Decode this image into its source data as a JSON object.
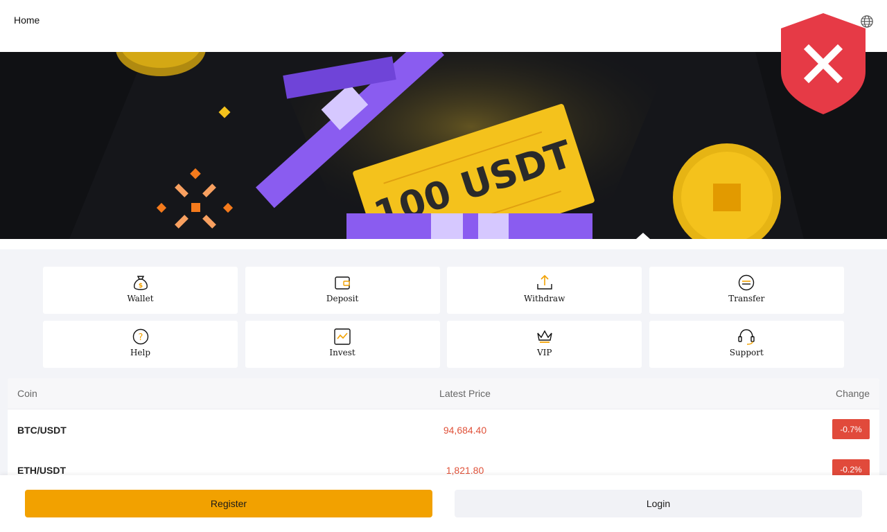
{
  "header": {
    "home_label": "Home",
    "language_icon": "globe-icon"
  },
  "banner": {
    "ticket_text": "100 USDT",
    "slide_count": 4,
    "active_slide": 0,
    "colors": {
      "gold": "#f4c21c",
      "purple": "#8a5cf0",
      "background": "#15161a"
    }
  },
  "security_badge": {
    "icon": "shield-x-icon",
    "color": "#e63a46"
  },
  "actions": [
    {
      "label": "Wallet",
      "icon": "money-bag-icon"
    },
    {
      "label": "Deposit",
      "icon": "wallet-icon"
    },
    {
      "label": "Withdraw",
      "icon": "upload-icon"
    },
    {
      "label": "Transfer",
      "icon": "transfer-icon"
    },
    {
      "label": "Help",
      "icon": "question-icon"
    },
    {
      "label": "Invest",
      "icon": "chart-icon"
    },
    {
      "label": "VIP",
      "icon": "crown-icon"
    },
    {
      "label": "Support",
      "icon": "headset-icon"
    }
  ],
  "market": {
    "columns": {
      "coin": "Coin",
      "price": "Latest Price",
      "change": "Change"
    },
    "rows": [
      {
        "pair": "BTC/USDT",
        "price": "94,684.40",
        "change": "-0.7%"
      },
      {
        "pair": "ETH/USDT",
        "price": "1,821.80",
        "change": "-0.2%"
      }
    ]
  },
  "footer": {
    "register_label": "Register",
    "login_label": "Login",
    "accent": "#f2a100"
  }
}
